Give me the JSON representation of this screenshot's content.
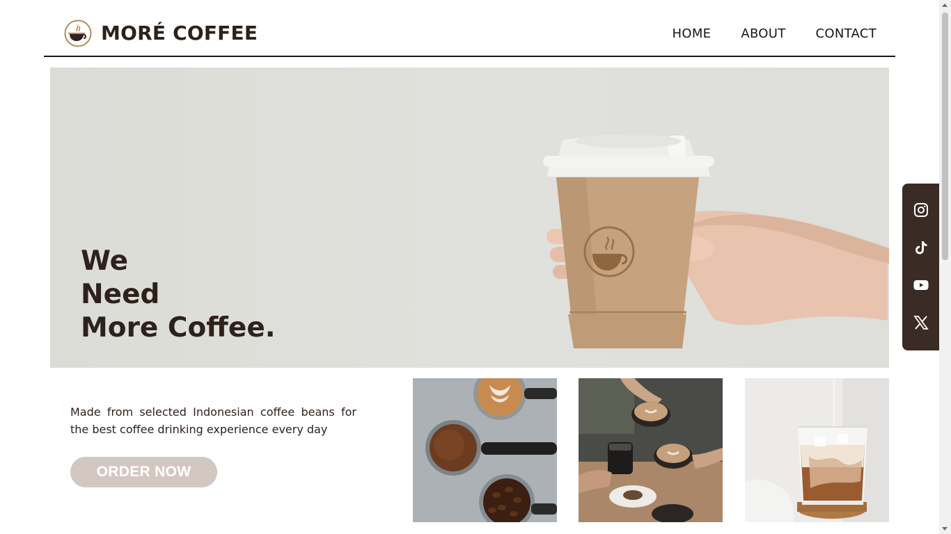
{
  "header": {
    "brand_name": "MORÉ COFFEE",
    "logo_icon": "coffee-cup-logo-icon",
    "nav": [
      {
        "label": "HOME"
      },
      {
        "label": "ABOUT"
      },
      {
        "label": "CONTACT"
      }
    ]
  },
  "hero": {
    "tagline_lines": [
      "We",
      "Need",
      "More Coffee."
    ]
  },
  "main": {
    "description": "Made from selected Indonesian coffee beans for the best coffee drinking experience every day",
    "order_button_label": "ORDER NOW"
  },
  "social": [
    {
      "icon": "instagram-icon"
    },
    {
      "icon": "tiktok-icon"
    },
    {
      "icon": "youtube-icon"
    },
    {
      "icon": "x-twitter-icon"
    }
  ],
  "colors": {
    "brand_dark": "#2e211b",
    "accent_brown": "#3a2b24",
    "button_bg": "#d3c8c1",
    "logo_gold": "#b58a5c"
  }
}
